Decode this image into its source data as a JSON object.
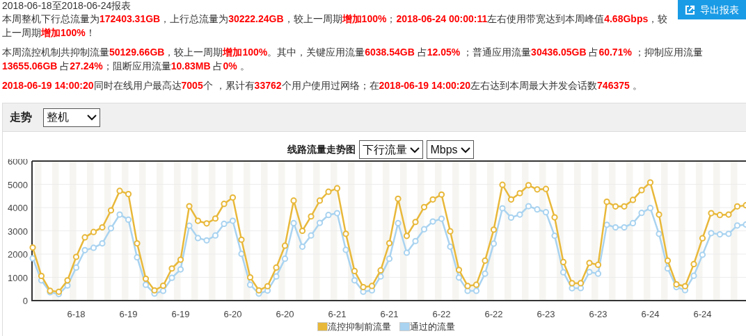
{
  "report_title": "2018-06-18至2018-06-24报表",
  "export_button": {
    "label": "导出报表"
  },
  "summary": [
    "本周整机下行总流量为**172403.31GB**，上行总流量为**30222.24GB**，较上一周期**增加100%**；**2018-06-24 00:00:11**左右使用带宽达到本周峰值**4.68Gbps**，较上一周期**增加100%**！",
    "本周流控机制共抑制流量**50129.66GB**，较上一周期**增加100%**。其中，关键应用流量**6038.54GB** 占**12.05%** ；普通应用流量**30436.05GB** 占**60.71%** ；抑制应用流量**13655.06GB** 占**27.24%**；阻断应用流量**10.83MB** 占**0%** 。",
    "**2018-06-19 14:00:20**同时在线用户最高达**7005**个 ，累计有**33762**个用户使用过网络；在**2018-06-19 14:00:20**左右达到本周最大并发会话数**746375** 。"
  ],
  "trend_panel": {
    "title": "走势",
    "scope_select": {
      "value": "整机"
    },
    "chart_title": "线路流量走势图",
    "direction_select": {
      "value": "下行流量"
    },
    "unit_select": {
      "value": "Mbps"
    },
    "chart_data": {
      "type": "line",
      "categories": [
        null,
        null,
        null,
        null,
        null,
        "6-18",
        null,
        null,
        null,
        null,
        null,
        "6-19",
        null,
        null,
        null,
        null,
        null,
        "6-19",
        null,
        null,
        null,
        null,
        null,
        "6-20",
        null,
        null,
        null,
        null,
        null,
        "6-20",
        null,
        null,
        null,
        null,
        null,
        "6-21",
        null,
        null,
        null,
        null,
        null,
        "6-21",
        null,
        null,
        null,
        null,
        null,
        "6-22",
        null,
        null,
        null,
        null,
        null,
        "6-22",
        null,
        null,
        null,
        null,
        null,
        "6-23",
        null,
        null,
        null,
        null,
        null,
        "6-23",
        null,
        null,
        null,
        null,
        null,
        "6-24",
        null,
        null,
        null,
        null,
        null,
        "6-24",
        null,
        null,
        null,
        null,
        null
      ],
      "ylim": [
        0,
        6000
      ],
      "grid": true,
      "yticks": [
        0,
        1000,
        2000,
        3000,
        4000,
        5000,
        6000
      ],
      "series": [
        {
          "name": "流控抑制前流量",
          "color": "#e8b83a",
          "marker": "circle",
          "values": [
            2280,
            1060,
            420,
            380,
            870,
            1880,
            2720,
            2950,
            3150,
            3880,
            4720,
            4580,
            2460,
            940,
            440,
            640,
            1380,
            1760,
            4060,
            3430,
            3320,
            3530,
            4160,
            4430,
            2620,
            1000,
            440,
            620,
            1420,
            2360,
            4300,
            3000,
            3620,
            4300,
            4680,
            4830,
            2870,
            1270,
            580,
            630,
            1300,
            2470,
            4380,
            2780,
            3380,
            4020,
            4350,
            4560,
            2980,
            1320,
            630,
            680,
            1720,
            3050,
            4980,
            4350,
            4620,
            4960,
            4780,
            4800,
            3580,
            1660,
            750,
            750,
            1620,
            1540,
            4250,
            4050,
            4050,
            4330,
            4750,
            5080,
            3700,
            1720,
            700,
            620,
            1570,
            2680,
            3760,
            3680,
            3700,
            4050,
            4100
          ]
        },
        {
          "name": "通过的流量",
          "color": "#a9d3f0",
          "marker": "circle",
          "values": [
            1820,
            870,
            360,
            280,
            650,
            1420,
            2170,
            2270,
            2460,
            3110,
            3700,
            3480,
            1860,
            680,
            300,
            420,
            980,
            1340,
            3220,
            2690,
            2590,
            2800,
            3300,
            3430,
            2010,
            680,
            300,
            430,
            1040,
            1800,
            3330,
            2320,
            2800,
            3340,
            3680,
            3760,
            2180,
            870,
            380,
            440,
            1040,
            1800,
            3330,
            2060,
            2560,
            3070,
            3400,
            3520,
            2320,
            990,
            420,
            420,
            1160,
            2450,
            3970,
            3570,
            3700,
            4060,
            3920,
            3800,
            2790,
            1220,
            530,
            540,
            1230,
            1160,
            3260,
            3150,
            3150,
            3330,
            3770,
            3980,
            2870,
            1380,
            580,
            450,
            1070,
            1970,
            2900,
            2850,
            2870,
            3230,
            3270
          ]
        }
      ]
    }
  }
}
